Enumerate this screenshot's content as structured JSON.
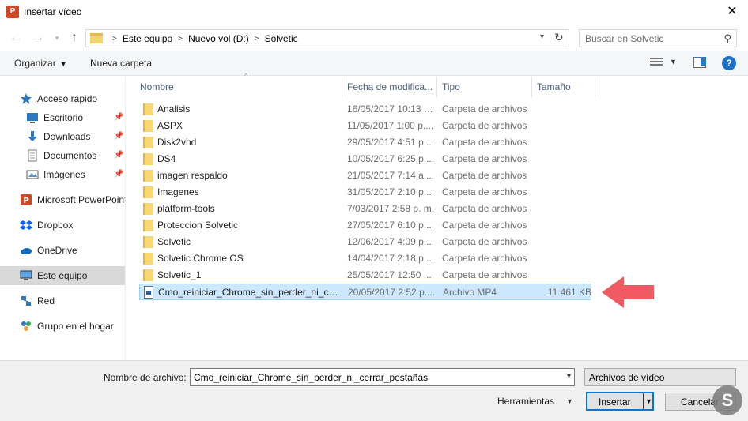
{
  "window": {
    "title": "Insertar vídeo",
    "app_icon_letter": "P"
  },
  "address": {
    "crumbs": [
      "Este equipo",
      "Nuevo vol (D:)",
      "Solvetic"
    ],
    "search_placeholder": "Buscar en Solvetic"
  },
  "toolbar": {
    "organize_label": "Organizar",
    "new_folder_label": "Nueva carpeta"
  },
  "sidebar": {
    "items": [
      {
        "label": "Acceso rápido",
        "icon": "star-icon"
      },
      {
        "label": "Escritorio",
        "icon": "desktop-icon",
        "pinned": true
      },
      {
        "label": "Downloads",
        "icon": "download-icon",
        "pinned": true
      },
      {
        "label": "Documentos",
        "icon": "document-icon",
        "pinned": true
      },
      {
        "label": "Imágenes",
        "icon": "image-icon",
        "pinned": true
      },
      {
        "label": "Microsoft PowerPoint",
        "icon": "powerpoint-icon"
      },
      {
        "label": "Dropbox",
        "icon": "dropbox-icon"
      },
      {
        "label": "OneDrive",
        "icon": "cloud-icon"
      },
      {
        "label": "Este equipo",
        "icon": "computer-icon",
        "selected": true
      },
      {
        "label": "Red",
        "icon": "network-icon"
      },
      {
        "label": "Grupo en el hogar",
        "icon": "homegroup-icon"
      }
    ]
  },
  "columns": {
    "name": "Nombre",
    "date": "Fecha de modifica...",
    "type": "Tipo",
    "size": "Tamaño"
  },
  "files": [
    {
      "name": "Analisis",
      "date": "16/05/2017 10:13 a...",
      "type": "Carpeta de archivos",
      "size": "",
      "kind": "folder"
    },
    {
      "name": "ASPX",
      "date": "11/05/2017 1:00 p....",
      "type": "Carpeta de archivos",
      "size": "",
      "kind": "folder"
    },
    {
      "name": "Disk2vhd",
      "date": "29/05/2017 4:51 p....",
      "type": "Carpeta de archivos",
      "size": "",
      "kind": "folder"
    },
    {
      "name": "DS4",
      "date": "10/05/2017 6:25 p....",
      "type": "Carpeta de archivos",
      "size": "",
      "kind": "folder"
    },
    {
      "name": "imagen respaldo",
      "date": "21/05/2017 7:14 a....",
      "type": "Carpeta de archivos",
      "size": "",
      "kind": "folder"
    },
    {
      "name": "Imagenes",
      "date": "31/05/2017 2:10 p....",
      "type": "Carpeta de archivos",
      "size": "",
      "kind": "folder"
    },
    {
      "name": "platform-tools",
      "date": "7/03/2017 2:58 p. m.",
      "type": "Carpeta de archivos",
      "size": "",
      "kind": "folder"
    },
    {
      "name": "Proteccion Solvetic",
      "date": "27/05/2017 6:10 p....",
      "type": "Carpeta de archivos",
      "size": "",
      "kind": "folder"
    },
    {
      "name": "Solvetic",
      "date": "12/06/2017 4:09 p....",
      "type": "Carpeta de archivos",
      "size": "",
      "kind": "folder"
    },
    {
      "name": "Solvetic Chrome OS",
      "date": "14/04/2017 2:18 p....",
      "type": "Carpeta de archivos",
      "size": "",
      "kind": "folder"
    },
    {
      "name": "Solvetic_1",
      "date": "25/05/2017 12:50 ...",
      "type": "Carpeta de archivos",
      "size": "",
      "kind": "folder"
    },
    {
      "name": "Cmo_reiniciar_Chrome_sin_perder_ni_cer...",
      "date": "20/05/2017 2:52 p....",
      "type": "Archivo MP4",
      "size": "11.461 KB",
      "kind": "file",
      "selected": true
    }
  ],
  "bottom": {
    "filename_label": "Nombre de archivo:",
    "filename_value": "Cmo_reiniciar_Chrome_sin_perder_ni_cerrar_pestañas",
    "filetype_value": "Archivos de vídeo",
    "tools_label": "Herramientas",
    "insert_label": "Insertar",
    "cancel_label": "Cancelar"
  },
  "colors": {
    "accent": "#0078d7",
    "selection": "#cce8ff",
    "arrow": "#f05a63"
  }
}
